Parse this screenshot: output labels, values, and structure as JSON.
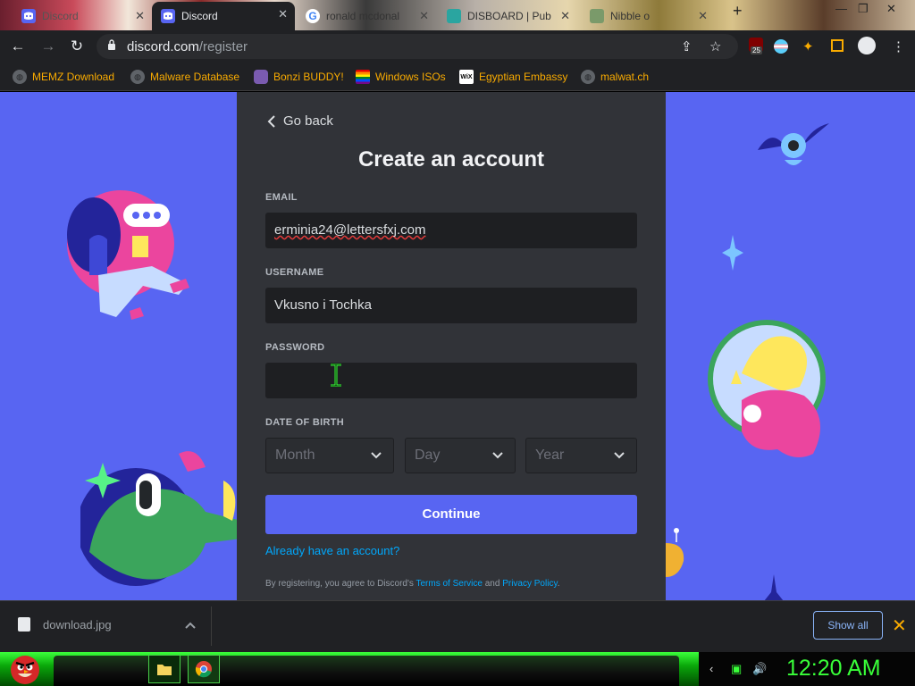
{
  "browser": {
    "tabs": [
      {
        "title": "Discord",
        "icon": "discord-icon"
      },
      {
        "title": "Discord",
        "icon": "discord-icon",
        "active": true
      },
      {
        "title": "ronald mcdonal",
        "icon": "google-icon"
      },
      {
        "title": "DISBOARD | Pub",
        "icon": "disboard-icon"
      },
      {
        "title": "Nibble o",
        "icon": "page-icon"
      }
    ],
    "url_host": "discord.com",
    "url_path": "/register",
    "extension_badge": "25",
    "bookmarks": [
      {
        "label": "MEMZ Download",
        "icon": "globe-icon"
      },
      {
        "label": "Malware Database",
        "icon": "globe-icon"
      },
      {
        "label": "Bonzi BUDDY!",
        "icon": "bonzi-icon"
      },
      {
        "label": "Windows ISOs",
        "icon": "windows-icon"
      },
      {
        "label": "Egyptian Embassy",
        "icon": "wix-icon"
      },
      {
        "label": "malwat.ch",
        "icon": "globe-icon"
      }
    ]
  },
  "register": {
    "go_back": "Go back",
    "title": "Create an account",
    "email_label": "EMAIL",
    "email_value": "erminia24@lettersfxj.com",
    "username_label": "USERNAME",
    "username_value": "Vkusno i Tochka",
    "password_label": "PASSWORD",
    "password_value": "",
    "dob_label": "DATE OF BIRTH",
    "month_placeholder": "Month",
    "day_placeholder": "Day",
    "year_placeholder": "Year",
    "continue": "Continue",
    "already": "Already have an account?",
    "terms_prefix": "By registering, you agree to Discord's ",
    "terms_link": "Terms of Service",
    "terms_and": " and ",
    "privacy_link": "Privacy Policy",
    "terms_suffix": "."
  },
  "downloads": {
    "file_name": "download.jpg",
    "show_all": "Show all"
  },
  "taskbar": {
    "clock": "12:20 AM"
  },
  "colors": {
    "blurple": "#5865f2",
    "card": "#313338",
    "input": "#1e1f22",
    "link": "#00a8fc",
    "bookmark_text": "#f9ab00",
    "clock": "#39ff39"
  }
}
